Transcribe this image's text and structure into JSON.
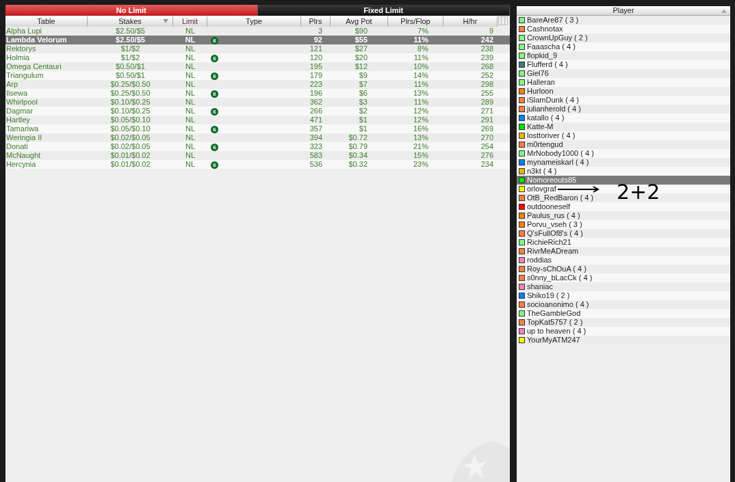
{
  "limit_tabs": [
    {
      "label": "No Limit",
      "selected": true
    },
    {
      "label": "Fixed Limit",
      "selected": false
    }
  ],
  "table": {
    "columns": [
      "Table",
      "Stakes",
      "Limit",
      "Type",
      "Plrs",
      "Avg Pot",
      "Plrs/Flop",
      "H/hr"
    ],
    "rows": [
      {
        "name": "Alpha Lupi",
        "stakes": "$2.50/$5",
        "limit": "NL",
        "plrs": "3",
        "avg_pot": "$90",
        "plrs_flop": "7%",
        "h_hr": "9",
        "selected": false
      },
      {
        "name": "Lambda Velorum",
        "stakes": "$2.50/$5",
        "limit": "NL",
        "type": "6",
        "plrs": "92",
        "avg_pot": "$55",
        "plrs_flop": "11%",
        "h_hr": "242",
        "selected": true
      },
      {
        "name": "Rektorys",
        "stakes": "$1/$2",
        "limit": "NL",
        "plrs": "121",
        "avg_pot": "$27",
        "plrs_flop": "8%",
        "h_hr": "238",
        "selected": false
      },
      {
        "name": "Holmia",
        "stakes": "$1/$2",
        "limit": "NL",
        "type": "6",
        "plrs": "120",
        "avg_pot": "$20",
        "plrs_flop": "11%",
        "h_hr": "239",
        "selected": false
      },
      {
        "name": "Omega Centauri",
        "stakes": "$0.50/$1",
        "limit": "NL",
        "plrs": "195",
        "avg_pot": "$12",
        "plrs_flop": "10%",
        "h_hr": "268",
        "selected": false
      },
      {
        "name": "Triangulum",
        "stakes": "$0.50/$1",
        "limit": "NL",
        "type": "6",
        "plrs": "179",
        "avg_pot": "$9",
        "plrs_flop": "14%",
        "h_hr": "252",
        "selected": false
      },
      {
        "name": "Arp",
        "stakes": "$0.25/$0.50",
        "limit": "NL",
        "plrs": "223",
        "avg_pot": "$7",
        "plrs_flop": "11%",
        "h_hr": "298",
        "selected": false
      },
      {
        "name": "Ilsewa",
        "stakes": "$0.25/$0.50",
        "limit": "NL",
        "type": "6",
        "plrs": "196",
        "avg_pot": "$6",
        "plrs_flop": "13%",
        "h_hr": "255",
        "selected": false
      },
      {
        "name": "Whirlpool",
        "stakes": "$0.10/$0.25",
        "limit": "NL",
        "plrs": "362",
        "avg_pot": "$3",
        "plrs_flop": "11%",
        "h_hr": "289",
        "selected": false
      },
      {
        "name": "Dagmar",
        "stakes": "$0.10/$0.25",
        "limit": "NL",
        "type": "6",
        "plrs": "266",
        "avg_pot": "$2",
        "plrs_flop": "12%",
        "h_hr": "271",
        "selected": false
      },
      {
        "name": "Hartley",
        "stakes": "$0.05/$0.10",
        "limit": "NL",
        "plrs": "471",
        "avg_pot": "$1",
        "plrs_flop": "12%",
        "h_hr": "291",
        "selected": false
      },
      {
        "name": "Tamariwa",
        "stakes": "$0.05/$0.10",
        "limit": "NL",
        "type": "6",
        "plrs": "357",
        "avg_pot": "$1",
        "plrs_flop": "16%",
        "h_hr": "269",
        "selected": false
      },
      {
        "name": "Weringia II",
        "stakes": "$0.02/$0.05",
        "limit": "NL",
        "plrs": "394",
        "avg_pot": "$0.72",
        "plrs_flop": "13%",
        "h_hr": "270",
        "selected": false
      },
      {
        "name": "Donati",
        "stakes": "$0.02/$0.05",
        "limit": "NL",
        "type": "6",
        "plrs": "323",
        "avg_pot": "$0.79",
        "plrs_flop": "21%",
        "h_hr": "254",
        "selected": false
      },
      {
        "name": "McNaught",
        "stakes": "$0.01/$0.02",
        "limit": "NL",
        "plrs": "583",
        "avg_pot": "$0.34",
        "plrs_flop": "15%",
        "h_hr": "276",
        "selected": false
      },
      {
        "name": "Hercynia",
        "stakes": "$0.01/$0.02",
        "limit": "NL",
        "type": "6",
        "plrs": "536",
        "avg_pot": "$0.32",
        "plrs_flop": "23%",
        "h_hr": "234",
        "selected": false
      }
    ]
  },
  "players": {
    "column": "Player",
    "items": [
      {
        "name": "BareAre87 ( 3 )",
        "color": "#80ff80",
        "selected": false
      },
      {
        "name": "Cashnotax",
        "color": "#ff7f40",
        "selected": false
      },
      {
        "name": "CrownUpGuy ( 2 )",
        "color": "#80ff80",
        "selected": false
      },
      {
        "name": "Faaascha ( 4 )",
        "color": "#80ff80",
        "selected": false
      },
      {
        "name": "flopkid_9",
        "color": "#80ff80",
        "selected": false
      },
      {
        "name": "Flufferd ( 4 )",
        "color": "#3d7a7a",
        "selected": false
      },
      {
        "name": "Giel76",
        "color": "#80ff80",
        "selected": false
      },
      {
        "name": "Halleran",
        "color": "#80ff80",
        "selected": false
      },
      {
        "name": "Hurloon",
        "color": "#ff8000",
        "selected": false
      },
      {
        "name": "iSlamDunk ( 4 )",
        "color": "#ff7f40",
        "selected": false
      },
      {
        "name": "julianherold ( 4 )",
        "color": "#ff7f40",
        "selected": false
      },
      {
        "name": "katallo ( 4 )",
        "color": "#0080ff",
        "selected": false
      },
      {
        "name": "Katte-M",
        "color": "#00e000",
        "selected": false
      },
      {
        "name": "losttoriver ( 4 )",
        "color": "#e6b800",
        "selected": false
      },
      {
        "name": "m0rtengud",
        "color": "#ff7f40",
        "selected": false
      },
      {
        "name": "MrNobody1000 ( 4 )",
        "color": "#80ff80",
        "selected": false
      },
      {
        "name": "mynameiskarl ( 4 )",
        "color": "#0080ff",
        "selected": false
      },
      {
        "name": "n3kt ( 4 )",
        "color": "#e6b800",
        "selected": false
      },
      {
        "name": "Nomoreouts85",
        "color": "#00e000",
        "selected": true
      },
      {
        "name": "orlovgraf",
        "color": "#ffff00",
        "selected": false
      },
      {
        "name": "OtB_RedBaron ( 4 )",
        "color": "#ff7f40",
        "selected": false
      },
      {
        "name": "outdooneself",
        "color": "#ff0000",
        "selected": false
      },
      {
        "name": "Paulus_rus ( 4 )",
        "color": "#ff8000",
        "selected": false
      },
      {
        "name": "Porvu_vseh ( 3 )",
        "color": "#ff8000",
        "selected": false
      },
      {
        "name": "Q'sFullOf8's ( 4 )",
        "color": "#ff7f40",
        "selected": false
      },
      {
        "name": "RichieRich21",
        "color": "#80ff80",
        "selected": false
      },
      {
        "name": "RivrMeADream",
        "color": "#ff7f40",
        "selected": false
      },
      {
        "name": "roddias",
        "color": "#ff80c0",
        "selected": false
      },
      {
        "name": "Roy-sChOuA ( 4 )",
        "color": "#ff7f40",
        "selected": false
      },
      {
        "name": "s0nny_bLacCk ( 4 )",
        "color": "#ff7f40",
        "selected": false
      },
      {
        "name": "shaniac",
        "color": "#ff80c0",
        "selected": false
      },
      {
        "name": "Shiko19 ( 2 )",
        "color": "#0080ff",
        "selected": false
      },
      {
        "name": "socioanonimo ( 4 )",
        "color": "#ff7f40",
        "selected": false
      },
      {
        "name": "TheGambleGod",
        "color": "#80ff80",
        "selected": false
      },
      {
        "name": "TopKat5757 ( 2 )",
        "color": "#ff7f40",
        "selected": false
      },
      {
        "name": "up to heaven ( 4 )",
        "color": "#ff80c0",
        "selected": false
      },
      {
        "name": "YourMyATM247",
        "color": "#ffff00",
        "selected": false
      }
    ]
  },
  "annotation": {
    "text": "2+2"
  }
}
